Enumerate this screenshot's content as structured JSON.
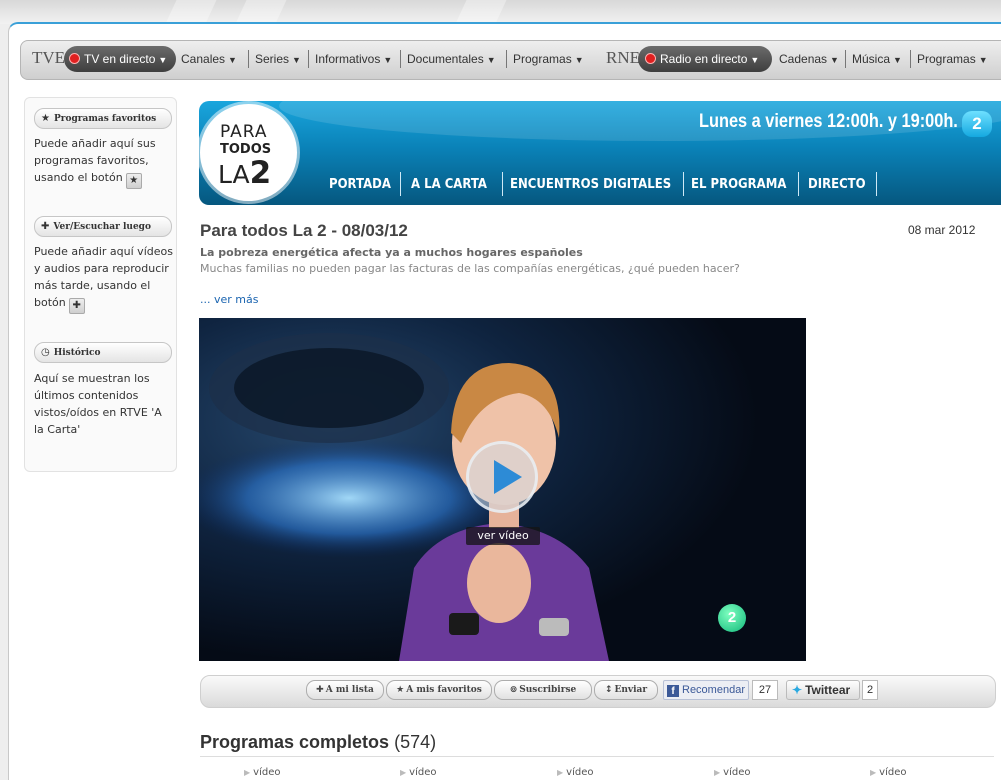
{
  "nav": {
    "tve_brand": "TVE",
    "tve_live": "TV en directo",
    "tve_items": [
      "Canales",
      "Series",
      "Informativos",
      "Documentales",
      "Programas"
    ],
    "rne_brand": "RNE",
    "rne_live": "Radio en directo",
    "rne_items": [
      "Cadenas",
      "Música",
      "Programas"
    ],
    "dropdown_glyph": "▼"
  },
  "sidebar": {
    "favoritos": {
      "title": "Programas favoritos",
      "text": "Puede añadir aquí sus programas favoritos, usando el botón"
    },
    "luego": {
      "title": "Ver/Escuchar luego",
      "text": "Puede añadir aquí vídeos y audios para reproducir más tarde, usando el botón"
    },
    "historico": {
      "title": "Histórico",
      "text": "Aquí se muestran los últimos contenidos vistos/oídos en RTVE 'A la Carta'"
    }
  },
  "banner": {
    "logo_line1": "PARA",
    "logo_line2": "TODOS",
    "logo_line3": "LA",
    "logo_line3_num": "2",
    "schedule": "Lunes a viernes 12:00h. y 19:00h.",
    "channel_badge": "2",
    "nav": [
      "PORTADA",
      "A LA CARTA",
      "ENCUENTROS DIGITALES",
      "EL PROGRAMA",
      "DIRECTO"
    ]
  },
  "episode": {
    "title": "Para todos La 2 - 08/03/12",
    "date": "08 mar 2012",
    "headline": "La pobreza energética afecta ya a muchos hogares españoles",
    "description": "Muchas familias no pueden pagar las facturas de las compañías energéticas, ¿qué pueden hacer?",
    "more_link": "... ver más"
  },
  "video": {
    "play_label": "ver vídeo",
    "watermark": "2"
  },
  "actions": {
    "mi_lista": "A mi lista",
    "favoritos": "A mis favoritos",
    "suscribirse": "Suscribirse",
    "enviar": "Enviar",
    "recomendar": "Recomendar",
    "recomendar_count": "27",
    "twittear": "Twittear",
    "twittear_count": "2"
  },
  "programas": {
    "title": "Programas completos",
    "count": "(574)",
    "items": [
      "vídeo",
      "vídeo",
      "vídeo",
      "vídeo",
      "vídeo"
    ]
  },
  "colors": {
    "accent": "#0a82b8",
    "nav_pill": "#3e3e3e",
    "live_dot": "#e02020",
    "link": "#1a64b0"
  }
}
